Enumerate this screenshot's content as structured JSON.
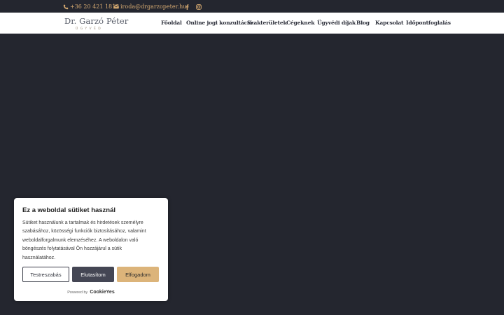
{
  "colors": {
    "background": "#24262f",
    "header": "#ffffff",
    "gold": "#d4a870",
    "accept": "#dcb47a",
    "reject": "#444654"
  },
  "topbar": {
    "phone": "+36 20 421 1818",
    "email": "iroda@drgarzopeter.hu",
    "phone_icon": "phone-icon",
    "email_icon": "envelope-icon",
    "social": [
      "facebook-icon",
      "instagram-icon"
    ]
  },
  "header": {
    "logo_title": "Dr. Garzó Péter",
    "logo_subtitle": "ÜGYVÉD",
    "nav": [
      "Főoldal",
      "Online jogi konzultáció",
      "Szakterületek",
      "Cégeknek",
      "Ügyvédi díjak",
      "Blog",
      "Kapcsolat",
      "Időpontfoglalás"
    ]
  },
  "cookie": {
    "title": "Ez a weboldal sütiket használ",
    "lines": [
      "Sütiket használunk a tartalmak és hirdetések személyre",
      "szabásához, közösségi funkciók biztosításához, valamint",
      "weboldalforgalmunk elemzéséhez. A weboldalon való",
      "böngészés folytatásával Ön hozzájárul a sütik",
      "használatához."
    ],
    "buttons": {
      "customize": "Testreszabás",
      "reject": "Elutasítom",
      "accept": "Elfogadom"
    },
    "powered_by": "Powered by",
    "brand": "CookieYes"
  }
}
